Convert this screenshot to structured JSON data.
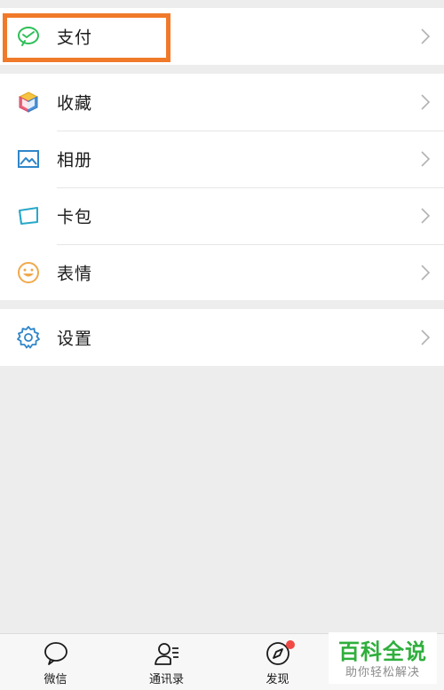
{
  "pay_group": {
    "items": [
      {
        "label": "支付",
        "icon": "wechat-pay-icon"
      }
    ]
  },
  "favorites_group": {
    "items": [
      {
        "label": "收藏",
        "icon": "favorites-cube-icon"
      },
      {
        "label": "相册",
        "icon": "album-picture-icon"
      },
      {
        "label": "卡包",
        "icon": "card-wallet-icon"
      },
      {
        "label": "表情",
        "icon": "smiley-face-icon"
      }
    ]
  },
  "settings_group": {
    "items": [
      {
        "label": "设置",
        "icon": "gear-icon"
      }
    ]
  },
  "tabbar": {
    "tabs": [
      {
        "label": "微信",
        "icon": "chat-bubble-icon"
      },
      {
        "label": "通讯录",
        "icon": "contacts-icon"
      },
      {
        "label": "发现",
        "icon": "compass-icon",
        "badge": "red-dot"
      }
    ]
  },
  "watermark": {
    "title": "百科全说",
    "subtitle": "助你轻松解决"
  },
  "colors": {
    "highlight": "#f07a2a",
    "pay_green": "#2dbf57",
    "icon_blue": "#2f86c9",
    "badge_red": "#f04a45",
    "watermark_green": "#2fae3c"
  }
}
